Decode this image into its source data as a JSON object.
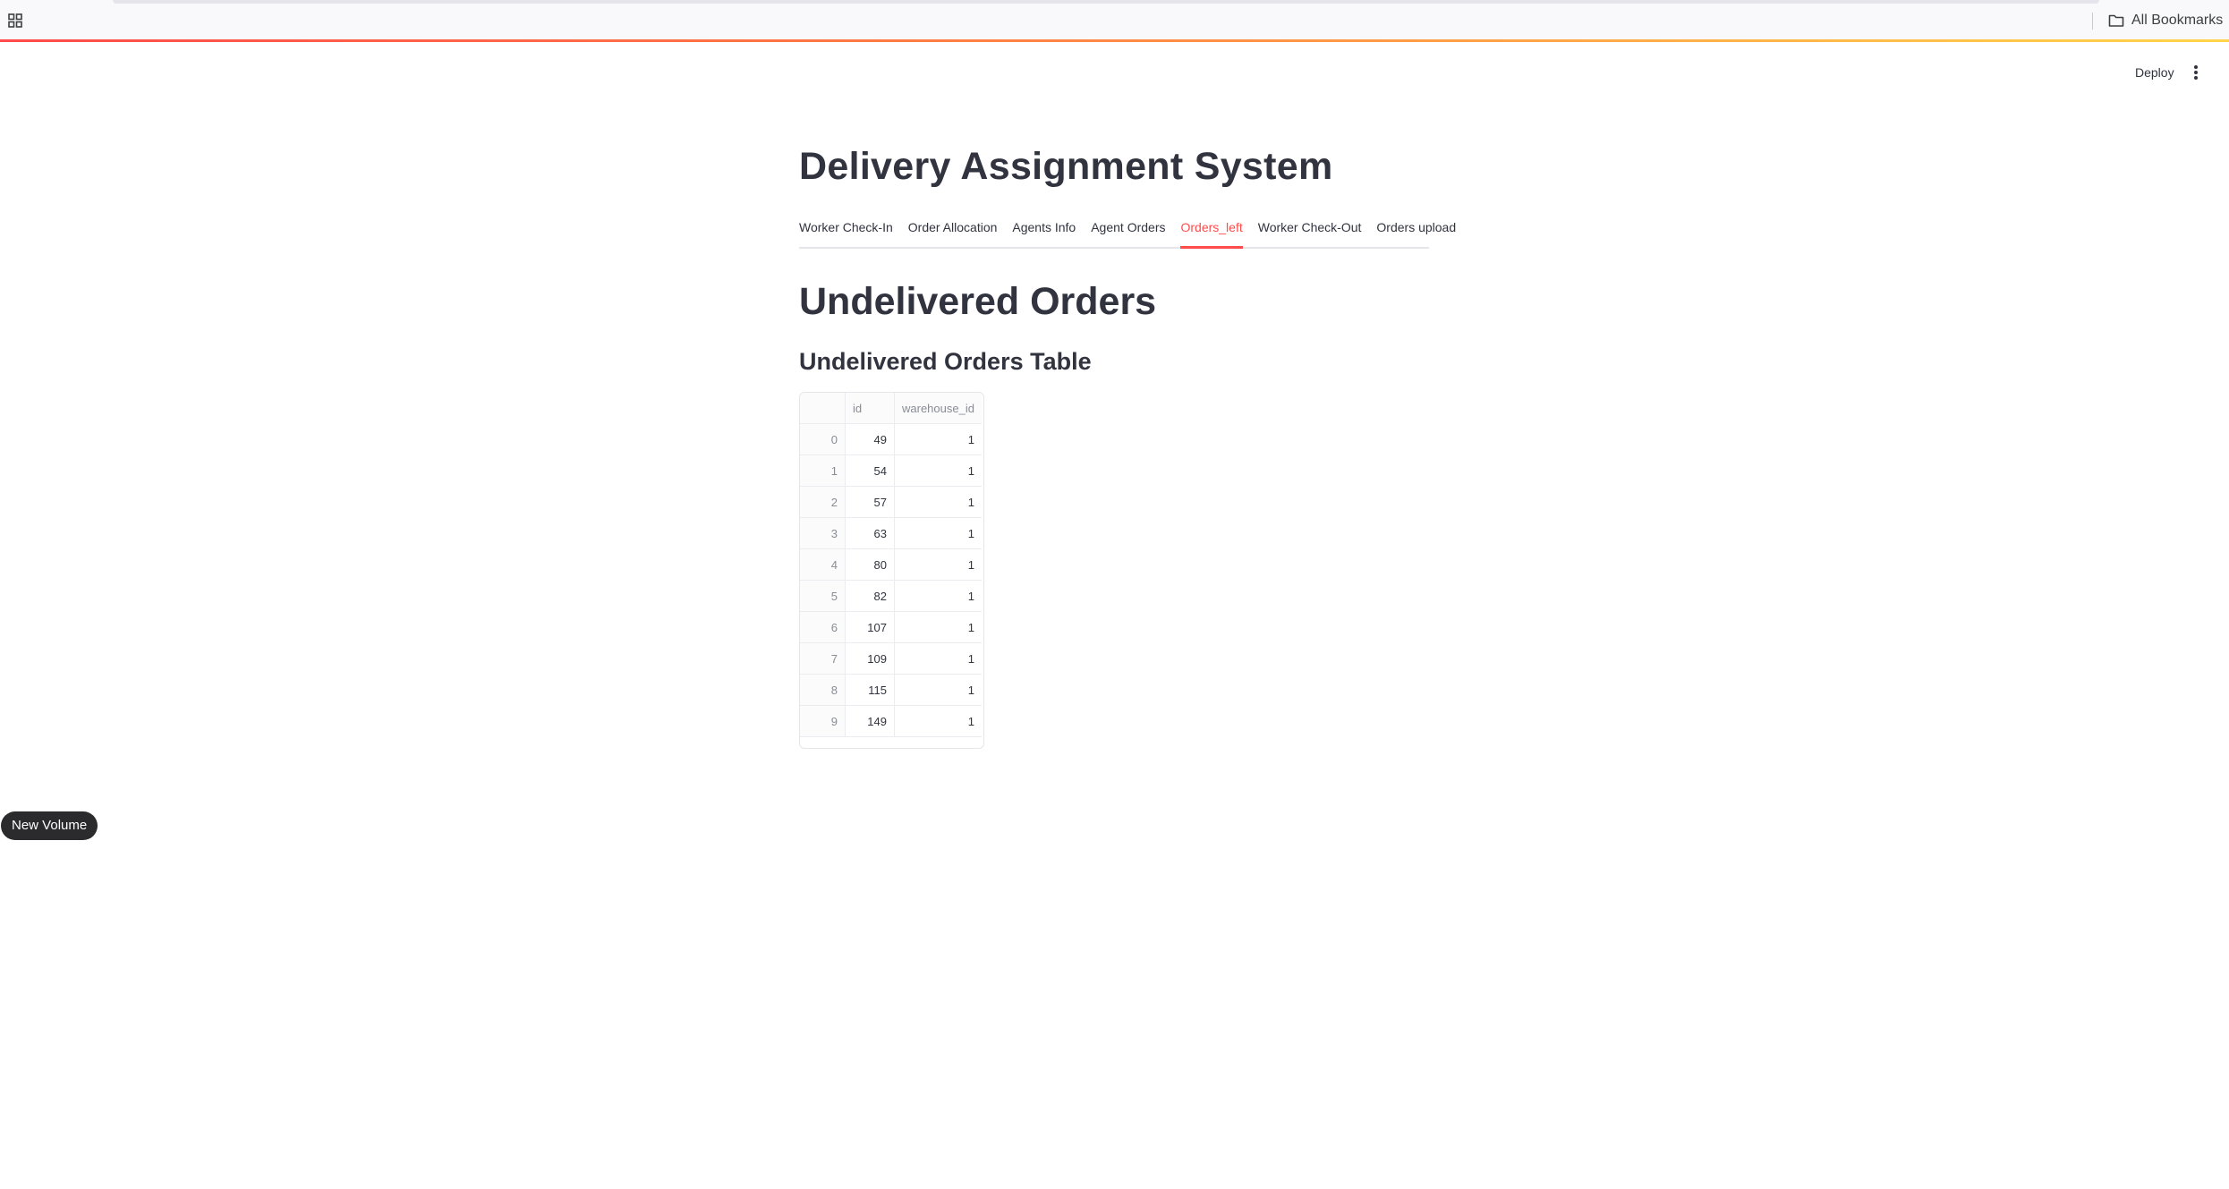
{
  "bookmarks_bar": {
    "all_bookmarks_label": "All Bookmarks"
  },
  "header": {
    "deploy_label": "Deploy"
  },
  "app": {
    "title": "Delivery Assignment System",
    "tabs": [
      {
        "label": "Worker Check-In",
        "active": false
      },
      {
        "label": "Order Allocation",
        "active": false
      },
      {
        "label": "Agents Info",
        "active": false
      },
      {
        "label": "Agent Orders",
        "active": false
      },
      {
        "label": "Orders_left",
        "active": true
      },
      {
        "label": "Worker Check-Out",
        "active": false
      },
      {
        "label": "Orders upload",
        "active": false
      }
    ],
    "section_title": "Undelivered Orders",
    "table_title": "Undelivered Orders Table",
    "table": {
      "columns": [
        "id",
        "warehouse_id"
      ],
      "rows": [
        {
          "index": "0",
          "id": "49",
          "warehouse_id": "1"
        },
        {
          "index": "1",
          "id": "54",
          "warehouse_id": "1"
        },
        {
          "index": "2",
          "id": "57",
          "warehouse_id": "1"
        },
        {
          "index": "3",
          "id": "63",
          "warehouse_id": "1"
        },
        {
          "index": "4",
          "id": "80",
          "warehouse_id": "1"
        },
        {
          "index": "5",
          "id": "82",
          "warehouse_id": "1"
        },
        {
          "index": "6",
          "id": "107",
          "warehouse_id": "1"
        },
        {
          "index": "7",
          "id": "109",
          "warehouse_id": "1"
        },
        {
          "index": "8",
          "id": "115",
          "warehouse_id": "1"
        },
        {
          "index": "9",
          "id": "149",
          "warehouse_id": "1"
        }
      ]
    }
  },
  "overlay": {
    "new_volume_label": "New Volume"
  },
  "colors": {
    "accent": "#ff4b4b",
    "text": "#31333f",
    "muted": "#8a8c95"
  },
  "icons": [
    "apps-grid-icon",
    "folder-icon",
    "kebab-menu-icon"
  ]
}
